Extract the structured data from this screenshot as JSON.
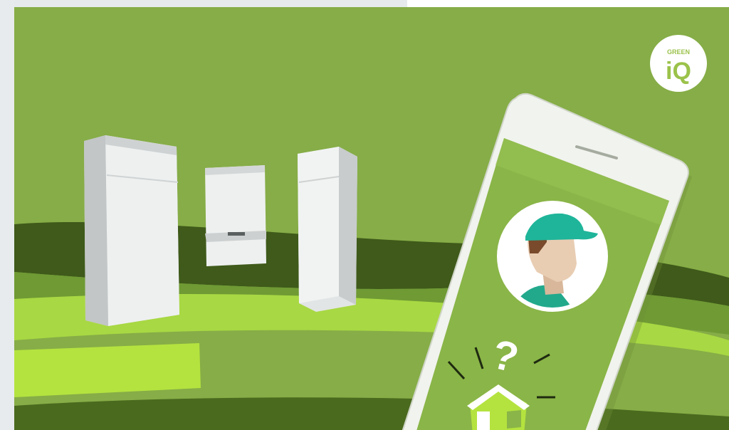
{
  "badge": {
    "line1": "GREEN",
    "line2": "iQ"
  },
  "phone": {
    "symbol": "?"
  },
  "icons": [
    "green-iq-logo",
    "technician-avatar-icon",
    "house-icon",
    "question-mark-icon"
  ],
  "colors": {
    "background_green": "#86ad47",
    "track_dark": "#3f5a1a",
    "track_light": "#a8d843",
    "phone_screen": "#8ab548",
    "cap_teal": "#1fb59a"
  }
}
